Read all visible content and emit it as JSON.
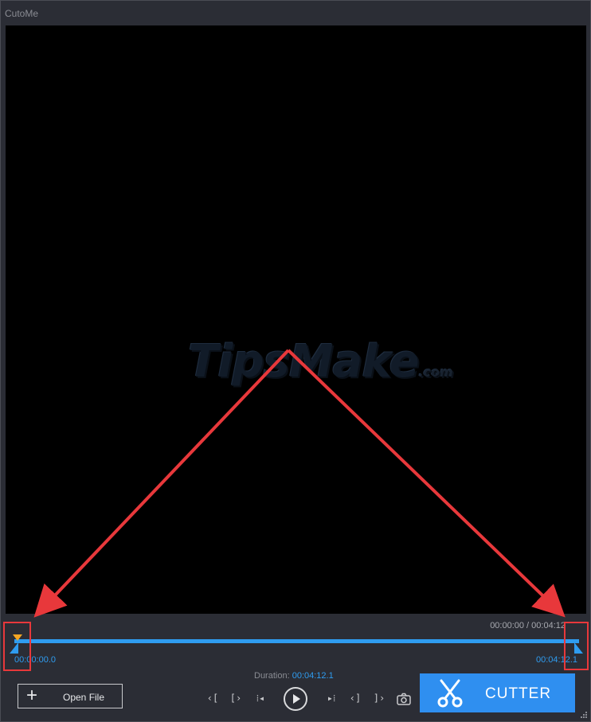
{
  "window": {
    "title": "CutoMe"
  },
  "watermark": {
    "brand": "TipsMake",
    "suffix": ".com"
  },
  "timeline": {
    "timecode": "00:00:00 / 00:04:12",
    "start_time": "00:00:00.0",
    "end_time": "00:04:12.1",
    "playhead_fraction": 0.0
  },
  "footer": {
    "duration_label": "Duration:",
    "duration_value": "00:04:12.1",
    "open_file_label": "Open File",
    "cutter_label": "CUTTER"
  },
  "controls": [
    {
      "name": "jump-to-start-mark-button",
      "glyph": "‹["
    },
    {
      "name": "set-start-mark-button",
      "glyph": "[›"
    },
    {
      "name": "prev-frame-button",
      "glyph": "⁞◂"
    },
    {
      "name": "next-frame-button",
      "glyph": "▸⁞"
    },
    {
      "name": "set-end-mark-button",
      "glyph": "‹]"
    },
    {
      "name": "jump-to-end-mark-button",
      "glyph": "]›"
    }
  ],
  "icons": {
    "plus": "plus-icon",
    "play": "play-icon",
    "snapshot": "camera-icon",
    "cutter": "scissors-icon"
  },
  "colors": {
    "accent": "#2f9cf0",
    "playhead": "#f5a623",
    "annotation": "#e8383b",
    "button": "#2f8ff0"
  }
}
